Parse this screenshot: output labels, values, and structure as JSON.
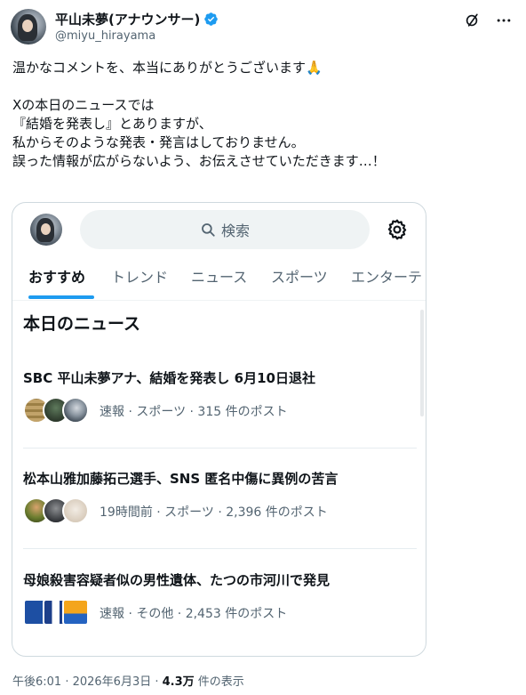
{
  "author": {
    "display_name": "平山未夢(アナウンサー)",
    "handle": "@miyu_hirayama"
  },
  "header_icons": [
    "grok-icon",
    "more-icon"
  ],
  "tweet": {
    "line1": "温かなコメントを、本当にありがとうございます🙏",
    "line2": "Xの本日のニュースでは",
    "line3": "『結婚を発表し』とありますが、",
    "line4": "私からそのような発表・発言はしておりません。",
    "line5": "誤った情報が広がらないよう、お伝えさせていただきます…！"
  },
  "card": {
    "search_placeholder": "検索",
    "tabs": [
      "おすすめ",
      "トレンド",
      "ニュース",
      "スポーツ",
      "エンターテ"
    ],
    "section_title": "本日のニュース",
    "news": [
      {
        "title": "SBC 平山未夢アナ、結婚を発表し 6月10日退社",
        "meta": "速報 · スポーツ · 315 件のポスト"
      },
      {
        "title": "松本山雅加藤拓己選手、SNS 匿名中傷に異例の苦言",
        "meta": "19時間前 · スポーツ · 2,396 件のポスト"
      },
      {
        "title": "母娘殺害容疑者似の男性遺体、たつの市河川で発見",
        "meta": "速報 · その他 · 2,453 件のポスト"
      }
    ]
  },
  "footer": {
    "time": "午後6:01 · 2026年6月3日 · ",
    "views_count": "4.3万",
    "views_label": " 件の表示"
  },
  "colors": {
    "accent": "#1d9bf0",
    "text": "#0f1419",
    "muted": "#536471"
  }
}
